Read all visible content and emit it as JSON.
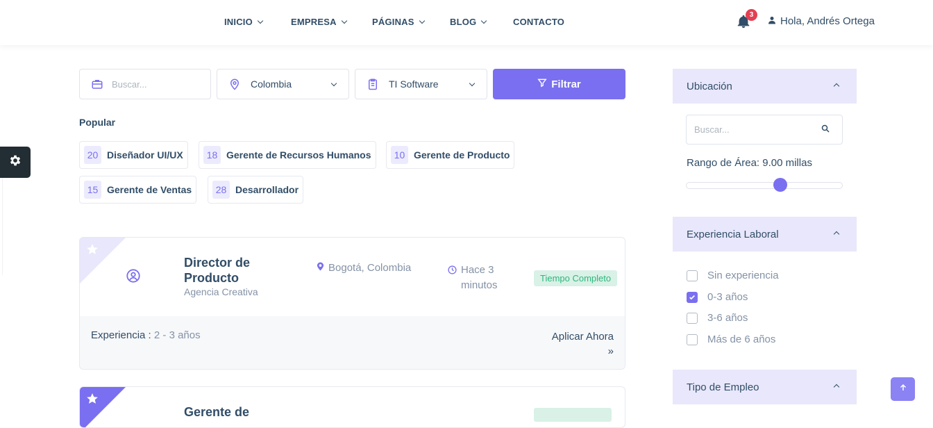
{
  "nav": {
    "items": [
      {
        "label": "INICIO"
      },
      {
        "label": "EMPRESA"
      },
      {
        "label": "PÁGINAS"
      },
      {
        "label": "BLOG"
      },
      {
        "label": "CONTACTO"
      }
    ],
    "notification_count": "3",
    "user_greeting": "Hola, Andrés Ortega"
  },
  "search": {
    "keyword_placeholder": "Buscar...",
    "location_value": "Colombia",
    "category_value": "TI Software",
    "filter_label": "Filtrar"
  },
  "popular": {
    "title": "Popular",
    "chips": [
      {
        "count": "20",
        "label": "Diseñador UI/UX"
      },
      {
        "count": "18",
        "label": "Gerente de Recursos Humanos"
      },
      {
        "count": "10",
        "label": "Gerente de Producto"
      },
      {
        "count": "15",
        "label": "Gerente de Ventas"
      },
      {
        "count": "28",
        "label": "Desarrollador"
      }
    ]
  },
  "jobs": [
    {
      "title": "Director de Producto",
      "company": "Agencia Creativa",
      "location": "Bogotá, Colombia",
      "posted": "Hace 3 minutos",
      "type": "Tiempo Completo",
      "experience_label": "Experiencia :",
      "experience_value": "2 - 3 años",
      "apply_label": "Aplicar Ahora",
      "apply_arrow": "»"
    },
    {
      "title": "Gerente de"
    }
  ],
  "sidebar": {
    "location": {
      "title": "Ubicación",
      "search_placeholder": "Buscar...",
      "range_label": "Rango de Área: 9.00 millas",
      "range_fraction": 0.6
    },
    "experience": {
      "title": "Experiencia Laboral",
      "options": [
        {
          "label": "Sin experiencia",
          "checked": false
        },
        {
          "label": "0-3 años",
          "checked": true
        },
        {
          "label": "3-6 años",
          "checked": false
        },
        {
          "label": "Más de 6 años",
          "checked": false
        }
      ]
    },
    "employment": {
      "title": "Tipo de Empleo"
    }
  },
  "colors": {
    "accent": "#7a6ff0",
    "accent_soft": "#e8e7fb",
    "badge": "#e43f52",
    "success": "#2eb67d"
  },
  "icons": [
    "chevron-down-icon",
    "bell-icon",
    "user-icon",
    "gear-icon",
    "briefcase-icon",
    "map-pin-icon",
    "clipboard-icon",
    "filter-icon",
    "star-icon",
    "user-circle-icon",
    "location-icon",
    "clock-icon",
    "search-icon",
    "chevron-up-icon",
    "check-icon",
    "arrow-up-icon"
  ]
}
